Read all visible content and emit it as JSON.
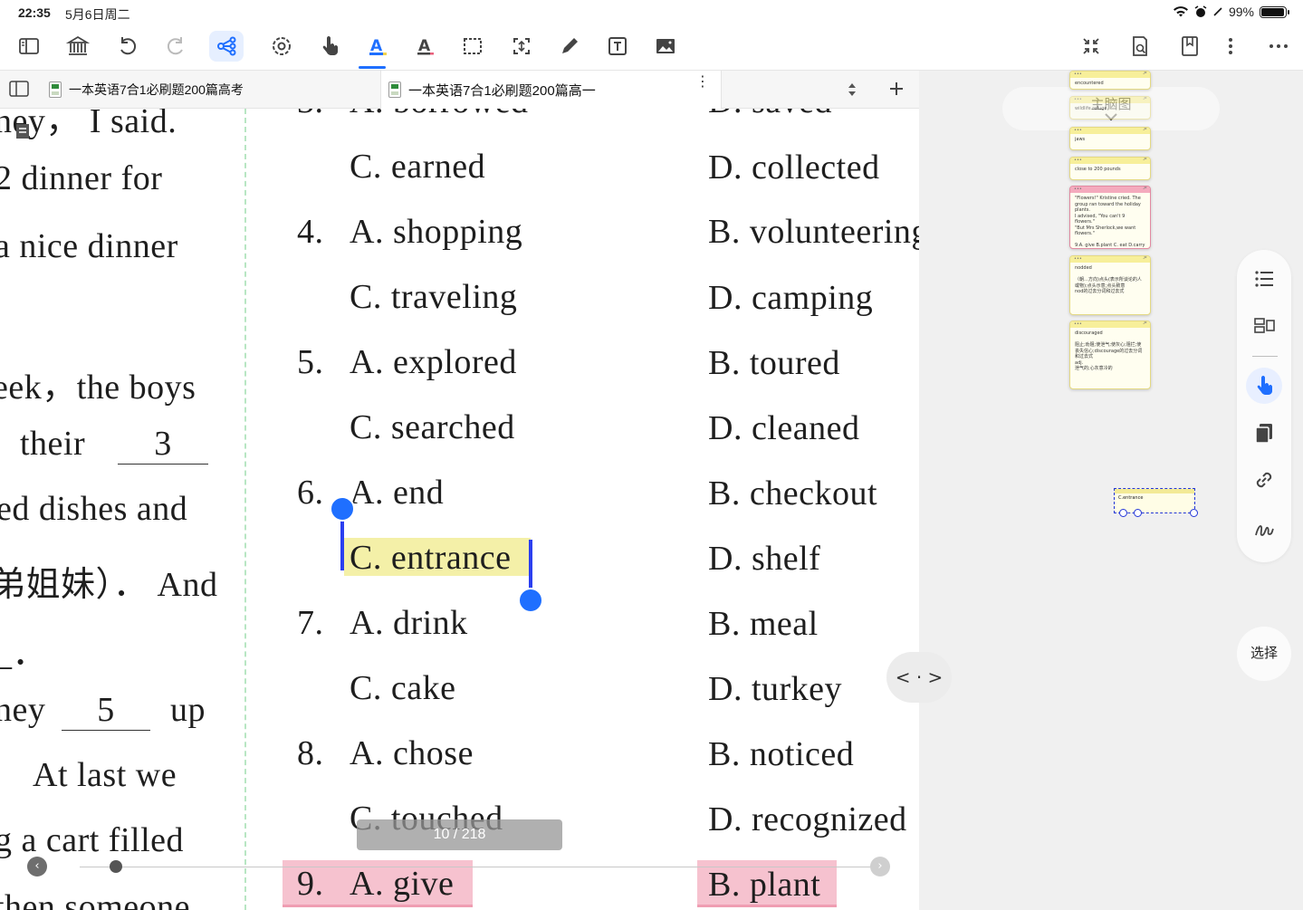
{
  "status": {
    "time": "22:35",
    "date": "5月6日周二",
    "battery": "99%"
  },
  "toolbar": {
    "left": [
      "sidebar-icon",
      "library-icon",
      "undo-icon",
      "redo-icon",
      "mindmap-icon",
      "lasso-icon",
      "hand-pointer-icon",
      "highlight-icon",
      "underline-icon",
      "screenshot-icon",
      "crop-icon",
      "pencil-icon",
      "textbox-icon",
      "image-icon"
    ],
    "right": [
      "collapse-icon",
      "search-doc-icon",
      "bookmark-icon",
      "more-vertical-icon",
      "more-horizontal-icon"
    ],
    "active": "mindmap-icon"
  },
  "tabs": [
    {
      "title": "一本英语7合1必刷题200篇高考"
    },
    {
      "title": "一本英语7合1必刷题200篇高一"
    }
  ],
  "doc": {
    "left_lines": [
      "ney，  I said.",
      "2   dinner for",
      "a nice  dinner",
      "eek，the boys",
      "their",
      "ed dishes and",
      "弟姐妹）． And",
      "_．",
      "ney",
      "up",
      "At  last  we",
      "g  a  cart  filled",
      "then   someone"
    ],
    "blanks": [
      "3",
      "5"
    ],
    "options": [
      {
        "q": "3.",
        "a": "A.  borrowed",
        "b": "D.  saved"
      },
      {
        "q": "",
        "a": "C.  earned",
        "b": "D.  collected"
      },
      {
        "q": "4.",
        "a": "A.  shopping",
        "b": "B.  volunteering"
      },
      {
        "q": "",
        "a": "C.  traveling",
        "b": "D.  camping"
      },
      {
        "q": "5.",
        "a": "A.  explored",
        "b": "B.  toured"
      },
      {
        "q": "",
        "a": "C.  searched",
        "b": "D.  cleaned"
      },
      {
        "q": "6.",
        "a": "A.  end",
        "b": "B.  checkout"
      },
      {
        "q": "",
        "a": "C.  entrance",
        "b": "D.  shelf"
      },
      {
        "q": "7.",
        "a": "A.  drink",
        "b": "B.  meal"
      },
      {
        "q": "",
        "a": "C.  cake",
        "b": "D.  turkey"
      },
      {
        "q": "8.",
        "a": "A.  chose",
        "b": "B.  noticed"
      },
      {
        "q": "",
        "a": "C.  touched",
        "b": "D.  recognized"
      },
      {
        "q": "9.",
        "a": "A.  give",
        "b": "B.  plant"
      }
    ],
    "page_indicator": "10 / 218",
    "page_progress": 0.046
  },
  "mindmap": {
    "title": "主脑图",
    "cards": [
      {
        "text": "encountered"
      },
      {
        "text": "wildlife refuge"
      },
      {
        "text": "jaws"
      },
      {
        "text": "close to 200 pounds"
      },
      {
        "text": "\"Flowers!\" Kristine cried. The group ran toward the holiday plants.\nI advised, \"You can't 9 flowers.\"\n\"But Mrs Sherlock,we want flowers.\"\n\n9.A. give B.plant C. eat D.carry",
        "pink": true
      },
      {
        "text": "nodded\n\n（朝…方向)点头(表示所谈论的人或物);点头示意;点头致意\nnod的过去分词和过去式"
      },
      {
        "text": "discouraged\n\n阻止;劝阻;使泄气;使灰心;阻拦;使丧失信心;discourage的过去分词和过去式\nadj.\n泄气的;心灰意冷的"
      }
    ],
    "selected_card": "C.entrance"
  },
  "side_tools": [
    "outline-icon",
    "layout-icon",
    "hand-pointer-icon",
    "copy-icon",
    "link-icon",
    "squiggle-icon"
  ],
  "select_label": "选择",
  "nav_label": "< · >",
  "colors": {
    "accent": "#1f6fff",
    "highlight_yellow": "#f4f0a8",
    "highlight_pink": "#f6c2cf",
    "selection": "#2b3ff0"
  }
}
